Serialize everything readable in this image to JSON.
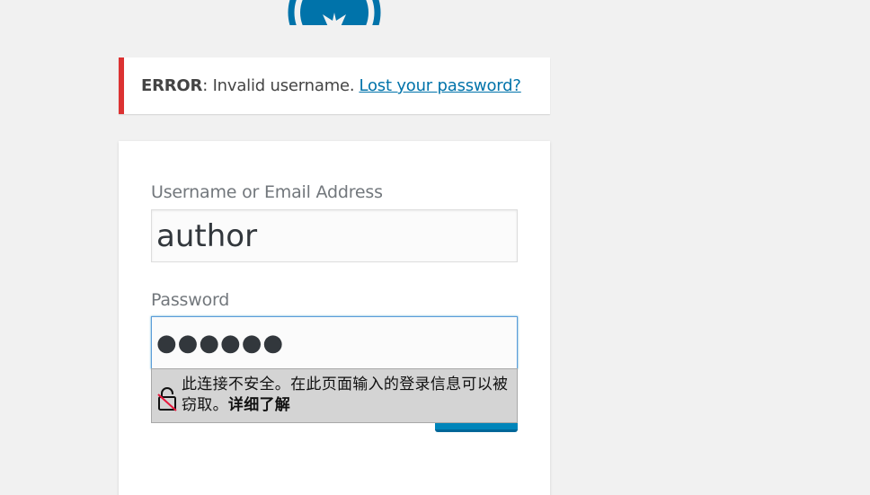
{
  "notice": {
    "error_label": "ERROR",
    "error_message": ": Invalid username.",
    "lost_password_link": "Lost your password?"
  },
  "form": {
    "username_label": "Username or Email Address",
    "username_value": "author",
    "password_label": "Password",
    "password_value_masked": "●●●●●●"
  },
  "browser_warning": {
    "message": "此连接不安全。在此页面输入的登录信息可以被窃取。",
    "learn_more": "详细了解"
  },
  "icons": {
    "logo": "wordpress-logo-icon",
    "lock": "insecure-lock-icon"
  },
  "colors": {
    "error_border": "#dc3232",
    "link": "#0073aa",
    "primary_button": "#0085ba",
    "focus_border": "#5b9dd9",
    "background": "#f1f1f1"
  }
}
